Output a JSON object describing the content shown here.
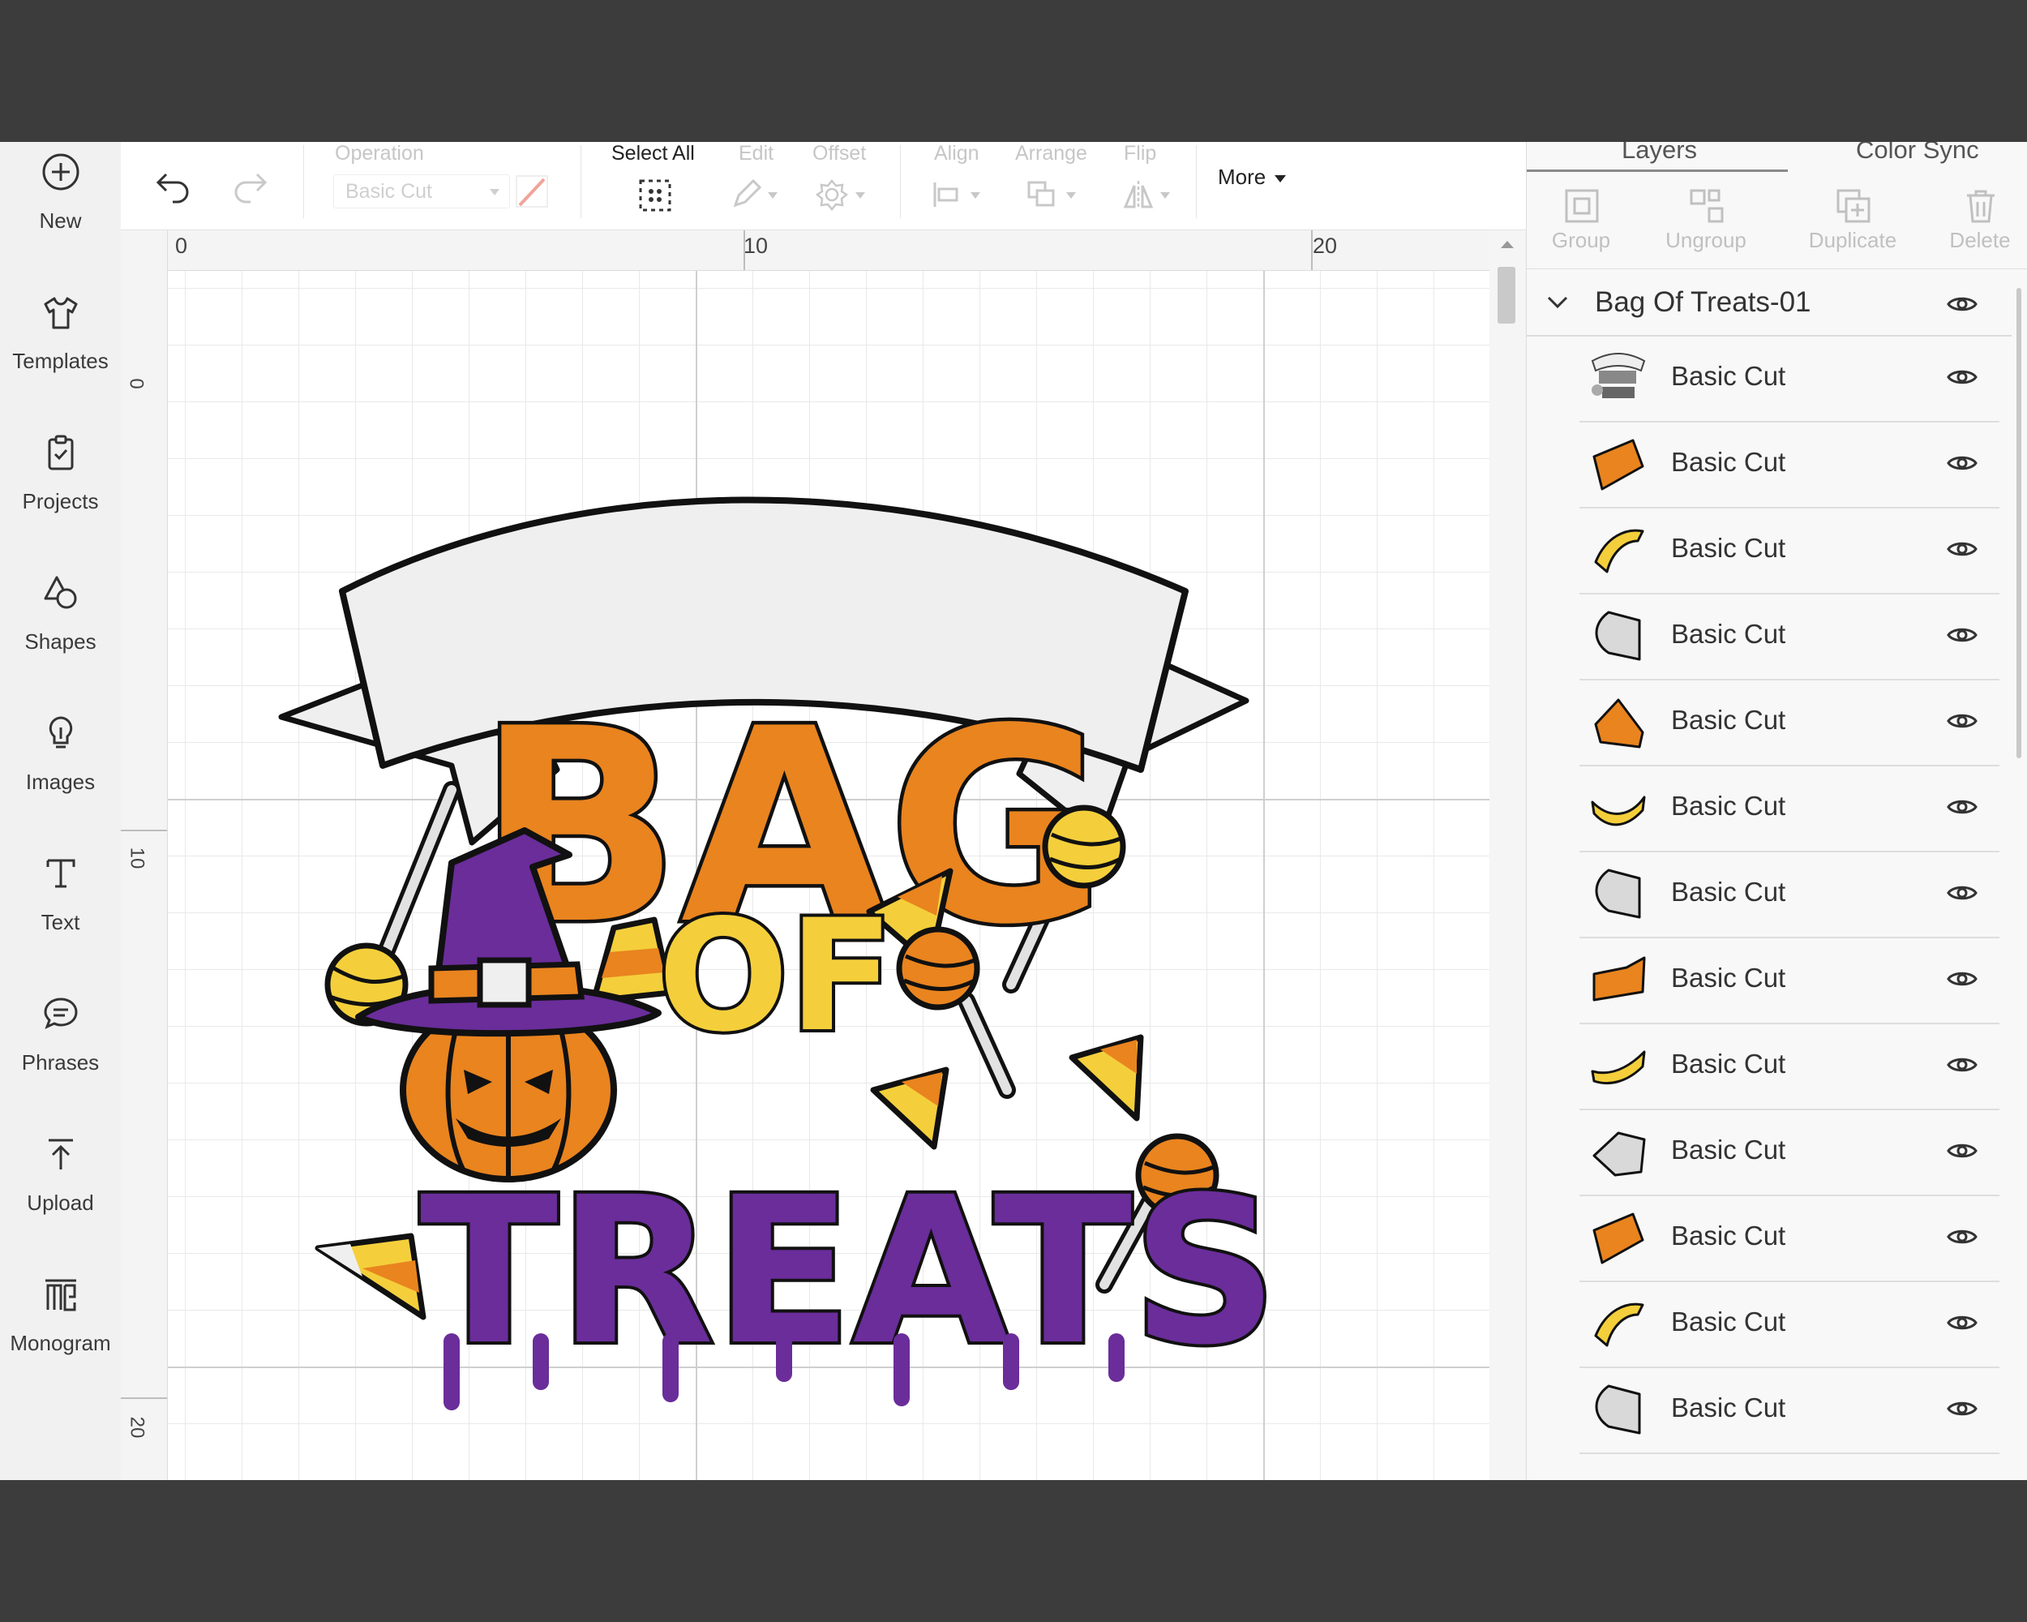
{
  "sidebar": {
    "items": [
      {
        "label": "New",
        "icon": "plus-circle-icon"
      },
      {
        "label": "Templates",
        "icon": "tshirt-icon"
      },
      {
        "label": "Projects",
        "icon": "clipboard-icon"
      },
      {
        "label": "Shapes",
        "icon": "shapes-icon"
      },
      {
        "label": "Images",
        "icon": "lightbulb-icon"
      },
      {
        "label": "Text",
        "icon": "text-icon"
      },
      {
        "label": "Phrases",
        "icon": "speech-bubble-icon"
      },
      {
        "label": "Upload",
        "icon": "upload-icon"
      },
      {
        "label": "Monogram",
        "icon": "monogram-icon"
      }
    ]
  },
  "toolbar": {
    "operation_label": "Operation",
    "operation_value": "Basic Cut",
    "select_all_label": "Select All",
    "edit_label": "Edit",
    "offset_label": "Offset",
    "align_label": "Align",
    "arrange_label": "Arrange",
    "flip_label": "Flip",
    "more_label": "More"
  },
  "rulers": {
    "top": [
      "0",
      "10",
      "20"
    ],
    "left": [
      "0",
      "10",
      "20"
    ]
  },
  "artwork": {
    "line1": "BAG",
    "line2": "OF",
    "line3": "TREATS",
    "colors": {
      "orange": "#e9841f",
      "yellow": "#f4cf3b",
      "purple": "#6a2d9a",
      "banner": "#efefef",
      "outline": "#111111"
    }
  },
  "panel": {
    "tabs": [
      "Layers",
      "Color Sync"
    ],
    "tools": [
      {
        "label": "Group",
        "icon": "group-icon"
      },
      {
        "label": "Ungroup",
        "icon": "ungroup-icon"
      },
      {
        "label": "Duplicate",
        "icon": "duplicate-icon"
      },
      {
        "label": "Delete",
        "icon": "trash-icon"
      }
    ],
    "group_name": "Bag Of Treats-01",
    "layers": [
      {
        "name": "Basic Cut",
        "thumb": "design",
        "color": "#444444"
      },
      {
        "name": "Basic Cut",
        "thumb": "a",
        "color": "#e9841f"
      },
      {
        "name": "Basic Cut",
        "thumb": "b",
        "color": "#f4cf3b"
      },
      {
        "name": "Basic Cut",
        "thumb": "c",
        "color": "#d9d9d9"
      },
      {
        "name": "Basic Cut",
        "thumb": "d",
        "color": "#e9841f"
      },
      {
        "name": "Basic Cut",
        "thumb": "e",
        "color": "#f4cf3b"
      },
      {
        "name": "Basic Cut",
        "thumb": "c",
        "color": "#d9d9d9"
      },
      {
        "name": "Basic Cut",
        "thumb": "f",
        "color": "#e9841f"
      },
      {
        "name": "Basic Cut",
        "thumb": "g",
        "color": "#f4cf3b"
      },
      {
        "name": "Basic Cut",
        "thumb": "h",
        "color": "#d9d9d9"
      },
      {
        "name": "Basic Cut",
        "thumb": "a",
        "color": "#e9841f"
      },
      {
        "name": "Basic Cut",
        "thumb": "b",
        "color": "#f4cf3b"
      },
      {
        "name": "Basic Cut",
        "thumb": "c",
        "color": "#d9d9d9"
      }
    ]
  }
}
